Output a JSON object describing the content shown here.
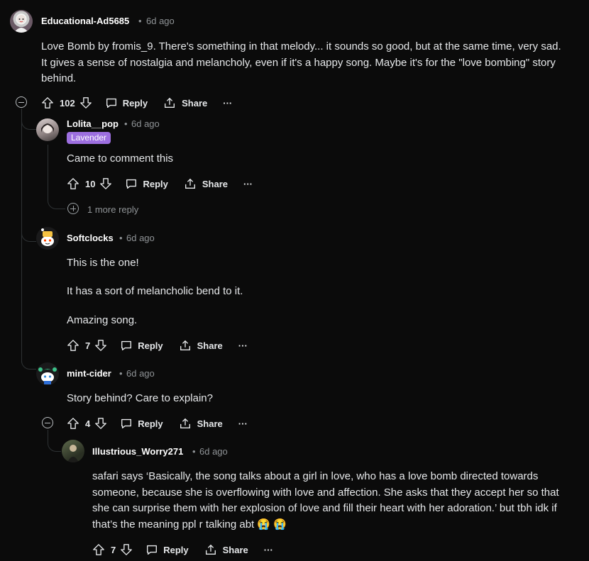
{
  "colors": {
    "background": "#0b0b0b",
    "badge": "#9d6fe0",
    "thread_line": "#2e3234"
  },
  "comments": [
    {
      "author": "Educational-Ad5685",
      "time": "6d ago",
      "body": [
        "Love Bomb by fromis_9. There's something in that melody... it sounds so good, but at the same time, very sad. It gives a sense of nostalgia and melancholy, even if it's a happy song. Maybe it's for the \"love bombing\" story behind."
      ],
      "votes": "102",
      "reply": "Reply",
      "share": "Share",
      "more": "···"
    },
    {
      "author": "Lolita__pop",
      "time": "6d ago",
      "flair": "Lavender",
      "body": [
        "Came to comment this"
      ],
      "votes": "10",
      "reply": "Reply",
      "share": "Share",
      "more": "···",
      "more_replies": "1 more reply"
    },
    {
      "author": "Softclocks",
      "time": "6d ago",
      "body": [
        "This is the one!",
        "It has a sort of melancholic bend to it.",
        "Amazing song."
      ],
      "votes": "7",
      "reply": "Reply",
      "share": "Share",
      "more": "···"
    },
    {
      "author": "mint-cider",
      "time": "6d ago",
      "body": [
        "Story behind? Care to explain?"
      ],
      "votes": "4",
      "reply": "Reply",
      "share": "Share",
      "more": "···"
    },
    {
      "author": "Illustrious_Worry271",
      "time": "6d ago",
      "body": [
        "safari says ‘Basically, the song talks about a girl in love, who has a love bomb directed towards someone, because she is overflowing with love and affection. She asks that they accept her so that she can surprise them with her explosion of love and fill their heart with her adoration.’ but tbh idk if that’s the meaning ppl r talking abt 😭 😭"
      ],
      "votes": "7",
      "reply": "Reply",
      "share": "Share",
      "more": "···"
    }
  ],
  "dot": "•"
}
